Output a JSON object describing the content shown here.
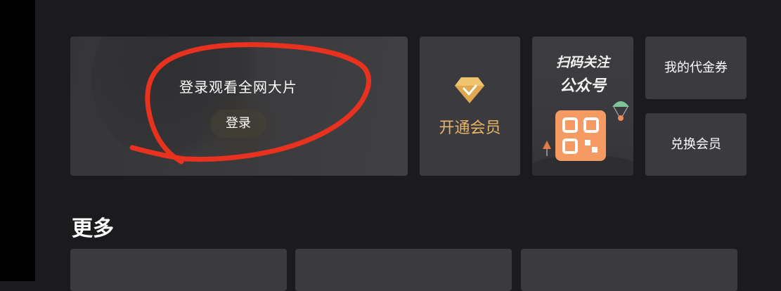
{
  "login_card": {
    "title": "登录观看全网大片",
    "button_label": "登录"
  },
  "vip_card": {
    "label": "开通会员",
    "icon": "diamond-icon",
    "accent_color": "#e8b565"
  },
  "qr_card": {
    "line1": "扫码关注",
    "line2": "公众号",
    "qr_color": "#f59a62"
  },
  "coupon_card": {
    "label": "我的代金券"
  },
  "redeem_card": {
    "label": "兑换会员"
  },
  "more_section": {
    "title": "更多"
  },
  "annotation": {
    "color": "#e8321f"
  }
}
